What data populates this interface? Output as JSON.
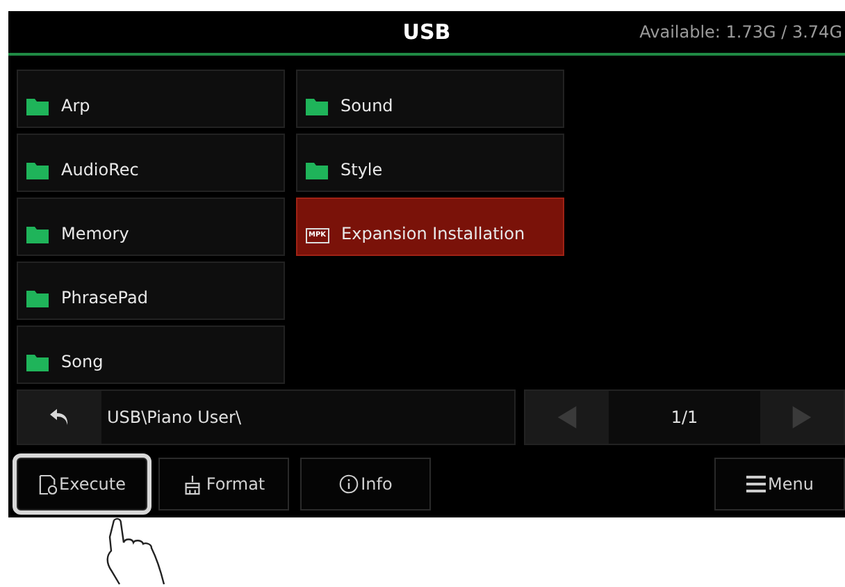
{
  "header": {
    "title": "USB",
    "available": "Available: 1.73G / 3.74G"
  },
  "files": [
    {
      "name": "Arp",
      "kind": "folder",
      "selected": false
    },
    {
      "name": "AudioRec",
      "kind": "folder",
      "selected": false
    },
    {
      "name": "Memory",
      "kind": "folder",
      "selected": false
    },
    {
      "name": "PhrasePad",
      "kind": "folder",
      "selected": false
    },
    {
      "name": "Song",
      "kind": "folder",
      "selected": false
    },
    {
      "name": "Sound",
      "kind": "folder",
      "selected": false
    },
    {
      "name": "Style",
      "kind": "folder",
      "selected": false
    },
    {
      "name": "Expansion Installation",
      "kind": "package",
      "selected": true
    }
  ],
  "path": "USB\\Piano User\\",
  "page": "1/1",
  "package_icon_text": "MPK",
  "buttons": [
    {
      "label": "Execute",
      "kind": "execute",
      "highlighted": true
    },
    {
      "label": "Format",
      "kind": "format",
      "highlighted": false
    },
    {
      "label": "Info",
      "kind": "info",
      "highlighted": false
    },
    {
      "label": "Menu",
      "kind": "menu",
      "highlighted": false
    }
  ]
}
